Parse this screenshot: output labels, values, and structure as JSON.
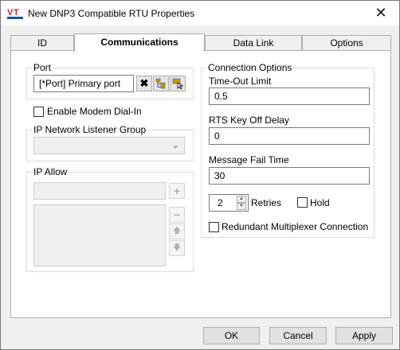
{
  "window": {
    "title": "New DNP3 Compatible RTU Properties",
    "logo_text": "VT",
    "close_glyph": "✕"
  },
  "tabs": [
    {
      "label": "ID",
      "active": false
    },
    {
      "label": "Communications",
      "active": true
    },
    {
      "label": "Data Link",
      "active": false
    },
    {
      "label": "Options",
      "active": false
    }
  ],
  "port": {
    "group_label": "Port",
    "value": "[*Port]    Primary port",
    "icons": [
      "clear-icon",
      "tree-browse-icon",
      "select-pointer-icon"
    ]
  },
  "modem": {
    "label": "Enable Modem Dial-In",
    "checked": false
  },
  "ip_listener": {
    "group_label": "IP Network Listener Group",
    "value": ""
  },
  "ip_allow": {
    "group_label": "IP Allow",
    "input_value": ""
  },
  "connection_options": {
    "group_label": "Connection Options",
    "timeout_label": "Time-Out Limit",
    "timeout_value": "0.5",
    "rts_label": "RTS Key Off Delay",
    "rts_value": "0",
    "fail_label": "Message Fail Time",
    "fail_value": "30",
    "retries_value": "2",
    "retries_label": "Retries",
    "hold_label": "Hold",
    "hold_checked": false,
    "redundant_label": "Redundant Multiplexer Connection",
    "redundant_checked": false
  },
  "buttons": {
    "ok": "OK",
    "cancel": "Cancel",
    "apply": "Apply"
  },
  "colors": {
    "logo_red": "#d0202a",
    "logo_blue": "#1d4fa0",
    "accent_icon": "#c8a000"
  }
}
